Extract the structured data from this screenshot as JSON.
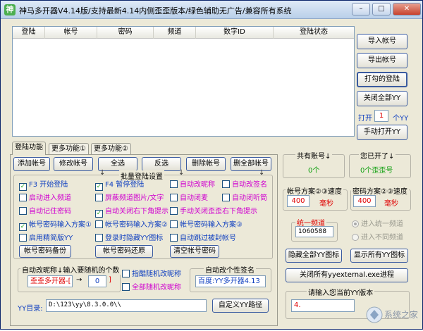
{
  "window": {
    "title": "神马多开器V4.14版/支持最新4.14内侧歪歪版本/绿色辅助无广告/兼容所有系统",
    "icon_text": "神"
  },
  "list": {
    "columns": [
      "登陆",
      "帐号",
      "密码",
      "频道",
      "数字ID",
      "登陆状态"
    ]
  },
  "right_buttons": {
    "import": "导入帐号",
    "export": "导出帐号",
    "check_login": "打勾的登陆",
    "close_all": "关闭全部YY",
    "open_prefix": "打开",
    "open_count": "1",
    "open_suffix": "个YY",
    "manual_open": "手动打开YY"
  },
  "tabs": [
    "登陆功能",
    "更多功能①",
    "更多功能②"
  ],
  "actions": {
    "add": "添加帐号",
    "edit": "修改帐号",
    "select_all": "全选",
    "invert": "反选",
    "delete": "删除帐号",
    "delete_all": "删全部帐号"
  },
  "batch": {
    "label": "批量登陆设置",
    "arrows": [
      "↓",
      "↓",
      "↓"
    ],
    "checks": [
      {
        "label": "F3 开始登陆",
        "checked": true
      },
      {
        "label": "F4 暂停登陆",
        "checked": true
      },
      {
        "label": "自动改昵称",
        "checked": false
      },
      {
        "label": "自动改签名",
        "checked": false
      },
      {
        "label": "启动进入频道",
        "checked": false
      },
      {
        "label": "屏蔽频道图片/文字",
        "checked": false
      },
      {
        "label": "自动闭麦",
        "checked": false
      },
      {
        "label": "自动闭听筒",
        "checked": false
      },
      {
        "label": "自动记住密码",
        "checked": false
      },
      {
        "label": "自动关闭右下角提示",
        "checked": true
      },
      {
        "label": "手动关闭歪歪右下角提示",
        "checked": false
      },
      {
        "label": "帐号密码输入方案①",
        "checked": true
      },
      {
        "label": "帐号密码输入方案②",
        "checked": false
      },
      {
        "label": "帐号密码输入方案③",
        "checked": false
      },
      {
        "label": "启用精简版YY",
        "checked": false
      },
      {
        "label": "登录时隐藏YY图标",
        "checked": false
      },
      {
        "label": "自动跳过被封帐号",
        "checked": false
      }
    ],
    "backup": "帐号密码备份",
    "restore": "帐号密码还原",
    "clear": "清空帐号密码"
  },
  "nick": {
    "label": "自动改昵称↓输入要随机的个数",
    "name": "歪歪多开器-[",
    "arrow": "→",
    "count": "0",
    "bracket": "]",
    "random_nick": "指酷随机改昵称",
    "all_random": "全部随机改昵称"
  },
  "sign": {
    "label": "自动改个性签名",
    "value": "百度:YY多开器4.13"
  },
  "yydir": {
    "label": "YY目录:",
    "path": "D:\\123\\yy\\8.3.0.0\\\\",
    "button": "自定义YY路径"
  },
  "stats": {
    "total_label": "共有账号↓",
    "total_value": "0个",
    "opened_label": "您已开了↓",
    "opened_value": "0个歪歪号"
  },
  "speed": {
    "account_label": "帐号方案②③速度",
    "account_value": "400",
    "account_unit": "毫秒",
    "password_label": "密码方案②③速度",
    "password_value": "400",
    "password_unit": "毫秒"
  },
  "unified": {
    "label": "统一频道",
    "value": "1060588",
    "radio_same": "进入统一频道",
    "radio_diff": "进入不同频道"
  },
  "bottom_buttons": {
    "hide_all": "隐藏全部YY图标",
    "show_all": "显示所有YY图标",
    "close_external": "关闭所有yyexternal.exe进程"
  },
  "version": {
    "label": "请输入您当前YY版本",
    "value": "4.",
    "watermark": "系统之家"
  },
  "colors": {
    "accent_border": "#3a5ba0",
    "green": "#10a010",
    "red": "#e00000",
    "blue_text": "#1040c0",
    "magenta_text": "#d000d0"
  }
}
